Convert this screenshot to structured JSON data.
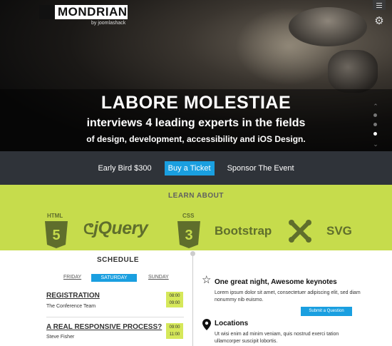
{
  "hero": {
    "logo_text": "MONDRIAN",
    "logo_sub": "by joomlashack",
    "title": "LABORE MOLESTIAE",
    "subtitle": "interviews 4 leading experts in the fields",
    "subtitle2": "of design, development, accessibility and iOS Design.",
    "menu_icon": "menu-icon",
    "settings_icon": "gear-icon",
    "slide_count": 3,
    "active_slide": 3
  },
  "ticket_bar": {
    "early_bird": "Early Bird $300",
    "buy_label": "Buy a Ticket",
    "sponsor": "Sponsor The Event"
  },
  "learn": {
    "title": "LEARN ABOUT",
    "items": {
      "html5_label": "HTML",
      "html5_num": "5",
      "jquery": "jQuery",
      "css3_label": "CSS",
      "css3_num": "3",
      "bootstrap": "Bootstrap",
      "svg": "SVG"
    },
    "colors": {
      "band": "#c6dc4c",
      "text": "#5f6e2c"
    }
  },
  "schedule": {
    "title": "SCHEDULE",
    "days": [
      "FRIDAY",
      "SATURDAY",
      "SUNDAY"
    ],
    "active_day": "SATURDAY",
    "events": [
      {
        "title": "REGISTRATION",
        "sub": "The Conference Team",
        "start": "08:00",
        "end": "09:00"
      },
      {
        "title": "A REAL RESPONSIVE PROCESS?",
        "sub": "Steve Fisher",
        "start": "09:00",
        "end": "11:00"
      }
    ]
  },
  "keynote": {
    "title": "One great night, Awesome keynotes",
    "text": "Lorem ipsum dolor sit amet, consectetuer adipiscing elit, sed diam nonummy nib euismo.",
    "button": "Submit a Question",
    "icon": "star-icon"
  },
  "locations": {
    "title": "Locations",
    "text": "Ut wisi enim ad minim veniam, quis nostrud exerci tation ullamcorper suscipit lobortis.",
    "icon": "map-pin-icon"
  },
  "accent": "#1a9fe0"
}
